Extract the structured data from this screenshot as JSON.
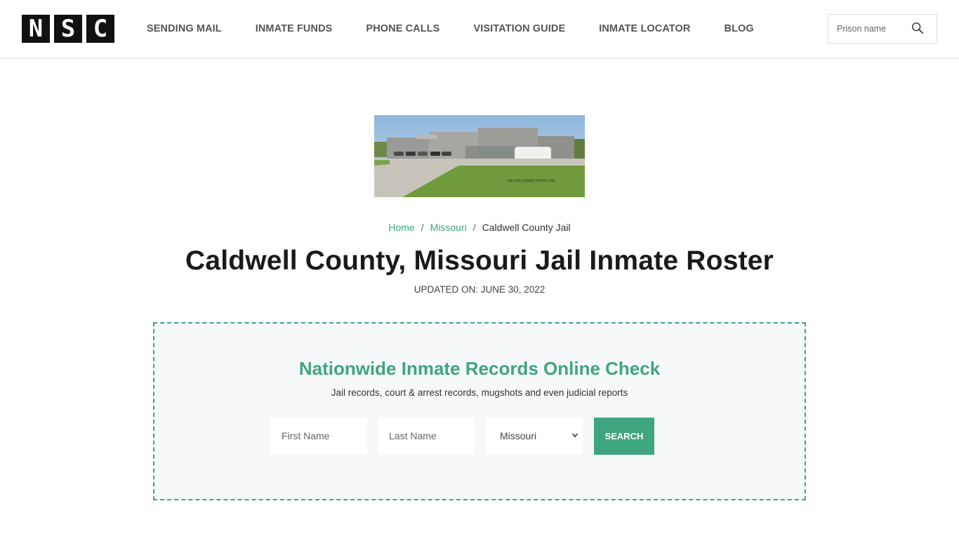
{
  "header": {
    "logo_letters": [
      "N",
      "S",
      "C"
    ],
    "nav": [
      {
        "label": "SENDING MAIL"
      },
      {
        "label": "INMATE FUNDS"
      },
      {
        "label": "PHONE CALLS"
      },
      {
        "label": "VISITATION GUIDE"
      },
      {
        "label": "INMATE LOCATOR"
      },
      {
        "label": "BLOG"
      }
    ],
    "search": {
      "placeholder": "Prison name",
      "value": "",
      "icon": "search-icon"
    }
  },
  "hero": {
    "image_alt": "Caldwell County Jail building",
    "watermark": "NSCJAILCORRECTIONS.COM"
  },
  "breadcrumb": {
    "items": [
      {
        "label": "Home",
        "link": true
      },
      {
        "label": "Missouri",
        "link": true
      },
      {
        "label": "Caldwell County Jail",
        "link": false
      }
    ],
    "separator": "/"
  },
  "page": {
    "title": "Caldwell County, Missouri Jail Inmate Roster",
    "updated": "UPDATED ON: JUNE 30, 2022"
  },
  "search_panel": {
    "title": "Nationwide Inmate Records Online Check",
    "subtitle": "Jail records, court & arrest records, mugshots and even judicial reports",
    "first_name_placeholder": "First Name",
    "last_name_placeholder": "Last Name",
    "state_selected": "Missouri",
    "button_label": "SEARCH"
  },
  "colors": {
    "accent": "#3fa57e",
    "logo": "#111111",
    "panel_bg": "#f6f8f9"
  }
}
